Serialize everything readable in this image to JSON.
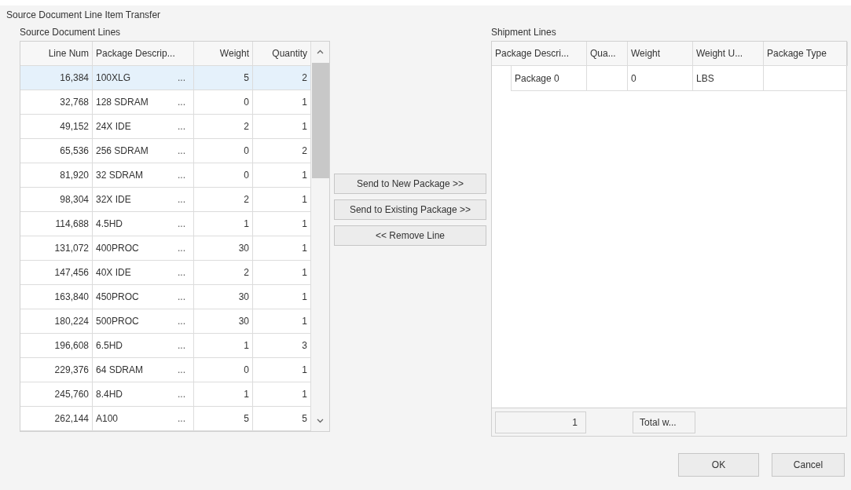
{
  "window": {
    "title": "Source Document Line Item Transfer"
  },
  "source_lines": {
    "label": "Source Document Lines",
    "columns": [
      "Line Num",
      "Package Descrip...",
      "Weight",
      "Quantity"
    ],
    "rows": [
      {
        "line_num": "16,384",
        "description": "100XLG",
        "button": "...",
        "weight": "5",
        "quantity": "2",
        "selected": true
      },
      {
        "line_num": "32,768",
        "description": "128 SDRAM",
        "button": "...",
        "weight": "0",
        "quantity": "1",
        "selected": false
      },
      {
        "line_num": "49,152",
        "description": "24X IDE",
        "button": "...",
        "weight": "2",
        "quantity": "1",
        "selected": false
      },
      {
        "line_num": "65,536",
        "description": "256 SDRAM",
        "button": "...",
        "weight": "0",
        "quantity": "2",
        "selected": false
      },
      {
        "line_num": "81,920",
        "description": "32 SDRAM",
        "button": "...",
        "weight": "0",
        "quantity": "1",
        "selected": false
      },
      {
        "line_num": "98,304",
        "description": "32X IDE",
        "button": "...",
        "weight": "2",
        "quantity": "1",
        "selected": false
      },
      {
        "line_num": "114,688",
        "description": "4.5HD",
        "button": "...",
        "weight": "1",
        "quantity": "1",
        "selected": false
      },
      {
        "line_num": "131,072",
        "description": "400PROC",
        "button": "...",
        "weight": "30",
        "quantity": "1",
        "selected": false
      },
      {
        "line_num": "147,456",
        "description": "40X IDE",
        "button": "...",
        "weight": "2",
        "quantity": "1",
        "selected": false
      },
      {
        "line_num": "163,840",
        "description": "450PROC",
        "button": "...",
        "weight": "30",
        "quantity": "1",
        "selected": false
      },
      {
        "line_num": "180,224",
        "description": "500PROC",
        "button": "...",
        "weight": "30",
        "quantity": "1",
        "selected": false
      },
      {
        "line_num": "196,608",
        "description": "6.5HD",
        "button": "...",
        "weight": "1",
        "quantity": "3",
        "selected": false
      },
      {
        "line_num": "229,376",
        "description": "64 SDRAM",
        "button": "...",
        "weight": "0",
        "quantity": "1",
        "selected": false
      },
      {
        "line_num": "245,760",
        "description": "8.4HD",
        "button": "...",
        "weight": "1",
        "quantity": "1",
        "selected": false
      },
      {
        "line_num": "262,144",
        "description": "A100",
        "button": "...",
        "weight": "5",
        "quantity": "5",
        "selected": false
      }
    ]
  },
  "transfer_buttons": [
    "Send to New Package >>",
    "Send to Existing Package >>",
    "<< Remove Line"
  ],
  "shipment_lines": {
    "label": "Shipment Lines",
    "columns": [
      "Package Descri...",
      "Qua...",
      "Weight",
      "Weight U...",
      "Package Type"
    ],
    "rows": [
      {
        "description": "Package 0",
        "weight": "0",
        "weight_unit": "LBS"
      }
    ],
    "footer": {
      "count": "1",
      "total_button": "Total w..."
    }
  },
  "buttons": [
    "OK",
    "Cancel"
  ]
}
